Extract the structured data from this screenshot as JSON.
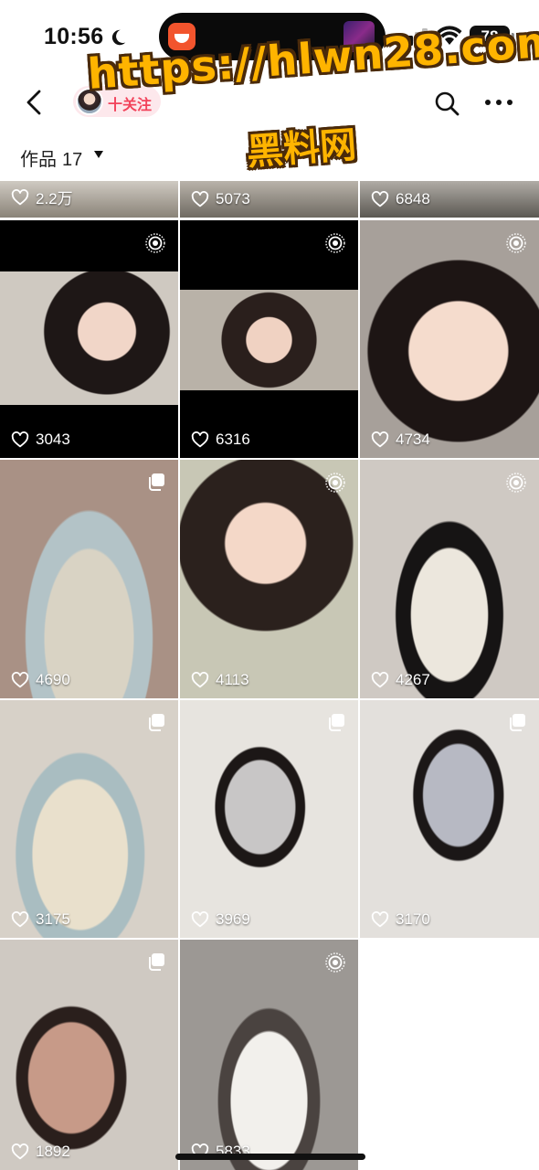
{
  "status_bar": {
    "time": "10:56",
    "battery": "78"
  },
  "header": {
    "follow_label": "十关注",
    "works_label": "作品",
    "works_count": "17"
  },
  "watermark": {
    "url": "https://hlwn28.com",
    "sub": "黑料网"
  },
  "colors": {
    "accent": "#f2435b",
    "watermark": "#ffb400"
  },
  "icons": {
    "back": "chevron-left-icon",
    "search": "search-icon",
    "more": "more-dots-icon",
    "like": "heart-icon",
    "live": "live-photo-icon",
    "multi": "multi-image-icon"
  },
  "posts": [
    {
      "likes": "2.2万",
      "badge": ""
    },
    {
      "likes": "5073",
      "badge": ""
    },
    {
      "likes": "6848",
      "badge": ""
    },
    {
      "likes": "3043",
      "badge": "live"
    },
    {
      "likes": "6316",
      "badge": "live"
    },
    {
      "likes": "4734",
      "badge": "live"
    },
    {
      "likes": "4690",
      "badge": "multi"
    },
    {
      "likes": "4113",
      "badge": "live"
    },
    {
      "likes": "4267",
      "badge": "live"
    },
    {
      "likes": "3175",
      "badge": "multi"
    },
    {
      "likes": "3969",
      "badge": "multi"
    },
    {
      "likes": "3170",
      "badge": "multi"
    },
    {
      "likes": "1892",
      "badge": "multi"
    },
    {
      "likes": "5833",
      "badge": "live"
    }
  ]
}
